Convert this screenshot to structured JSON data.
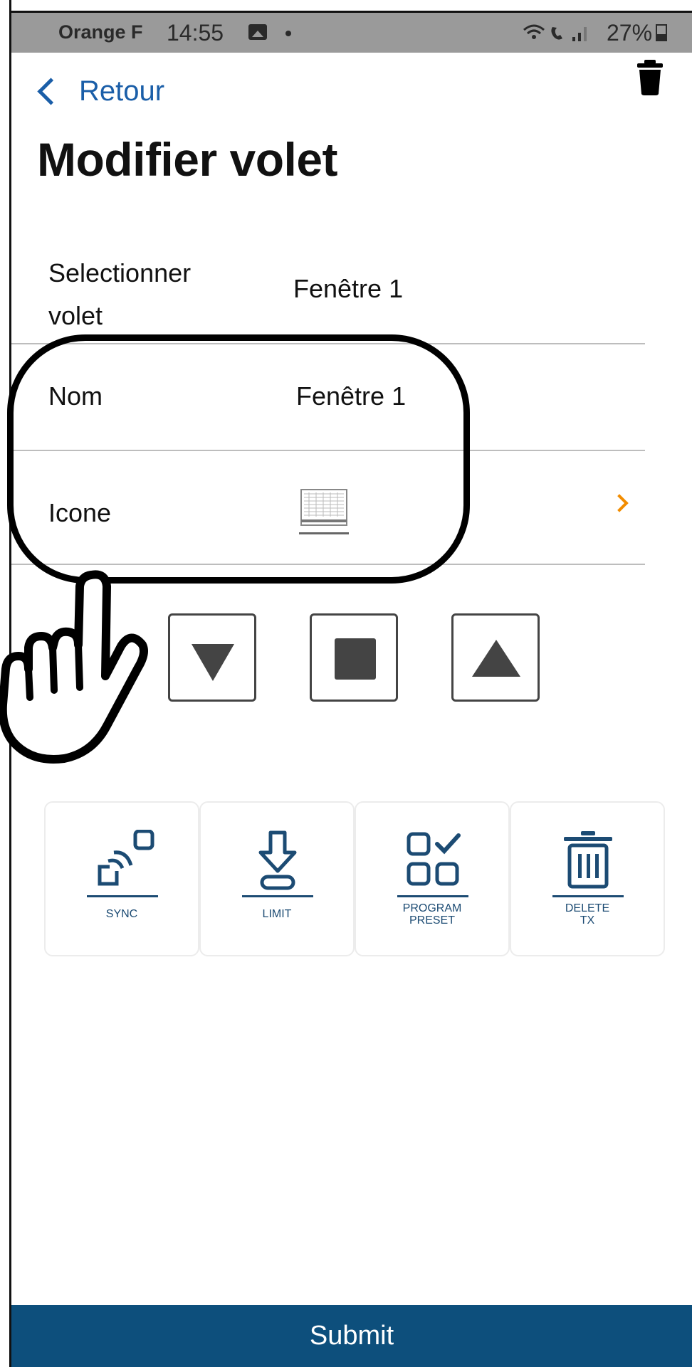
{
  "status_bar": {
    "carrier": "Orange F",
    "time": "14:55",
    "icons": "▽☎.┃",
    "battery": "27%"
  },
  "header": {
    "back_label": "Retour",
    "title": "Modifier volet"
  },
  "form": {
    "select_label": "Selectionner volet",
    "select_value": "Fenêtre 1",
    "name_label": "Nom",
    "name_value": "Fenêtre 1",
    "icon_label": "Icone"
  },
  "controls": [
    "chevron-down",
    "stop",
    "chevron-up"
  ],
  "tools": [
    {
      "label": "SYNC",
      "icon": "sync-icon"
    },
    {
      "label": "LIMIT",
      "icon": "limit-icon"
    },
    {
      "label": "PROGRAM\nPRESET",
      "icon": "program-preset-icon"
    },
    {
      "label": "DELETE\nTX",
      "icon": "delete-tx-icon"
    }
  ],
  "footer": {
    "submit_label": "Submit"
  },
  "colors": {
    "accent_blue": "#1a5ea8",
    "footer_blue": "#0d4f7c",
    "orange": "#f28c00",
    "tool_text": "#1c4b73"
  }
}
